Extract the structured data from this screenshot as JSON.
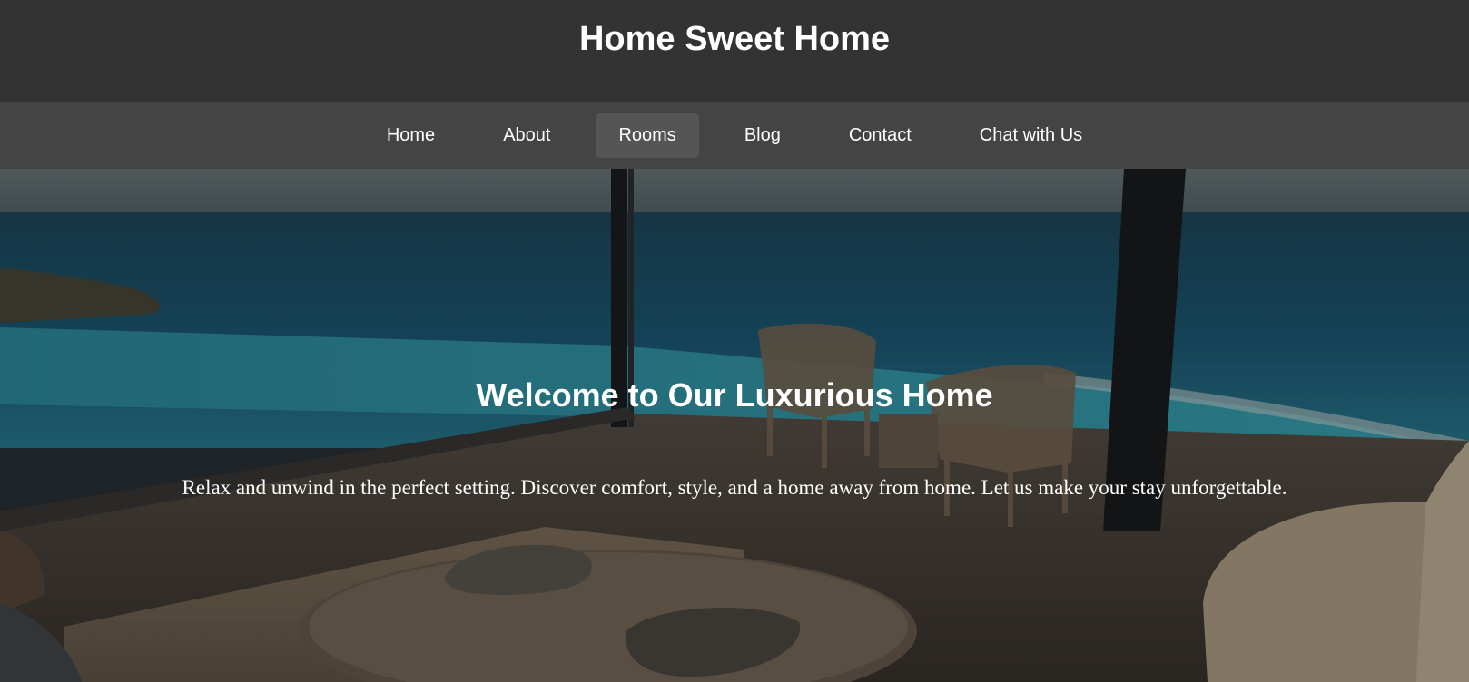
{
  "header": {
    "title": "Home Sweet Home"
  },
  "nav": {
    "items": [
      {
        "label": "Home",
        "active": false
      },
      {
        "label": "About",
        "active": false
      },
      {
        "label": "Rooms",
        "active": true
      },
      {
        "label": "Blog",
        "active": false
      },
      {
        "label": "Contact",
        "active": false
      },
      {
        "label": "Chat with Us",
        "active": false
      }
    ]
  },
  "hero": {
    "heading": "Welcome to Our Luxurious Home",
    "text": "Relax and unwind in the perfect setting. Discover comfort, style, and a home away from home. Let us make your stay unforgettable."
  },
  "colors": {
    "header_bg": "#333333",
    "nav_bg": "#444444",
    "nav_active_bg": "#555555",
    "text": "#ffffff"
  }
}
